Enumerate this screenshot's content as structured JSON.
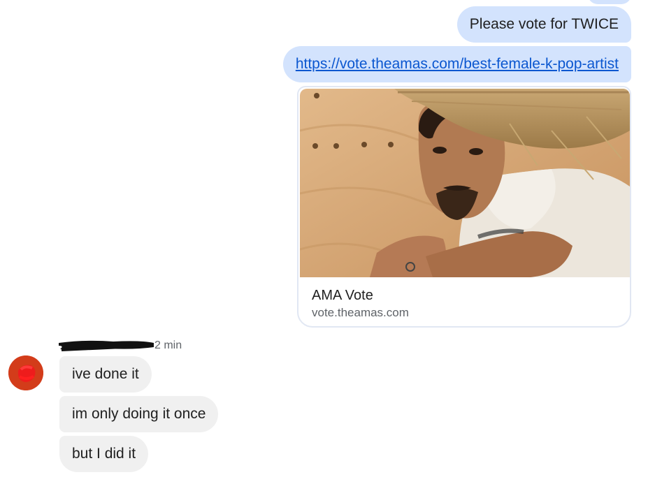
{
  "thread": {
    "outgoing": [
      {
        "text": "Please vote for TWICE"
      },
      {
        "text": "https://vote.theamas.com/best-female-k-pop-artist"
      }
    ],
    "link_preview": {
      "image_icon": "photo-man-straw-hat",
      "title": "AMA Vote",
      "domain": "vote.theamas.com"
    },
    "incoming": {
      "sender_name_redacted": true,
      "timestamp": "2 min",
      "avatar_color": "#d33c1a",
      "messages": [
        {
          "text": "ive done it"
        },
        {
          "text": "im only doing it once"
        },
        {
          "text": "but I did it"
        }
      ]
    }
  },
  "colors": {
    "outgoing_bubble": "#d3e3fd",
    "incoming_bubble": "#f0f0f0",
    "link": "#0b57d0"
  }
}
